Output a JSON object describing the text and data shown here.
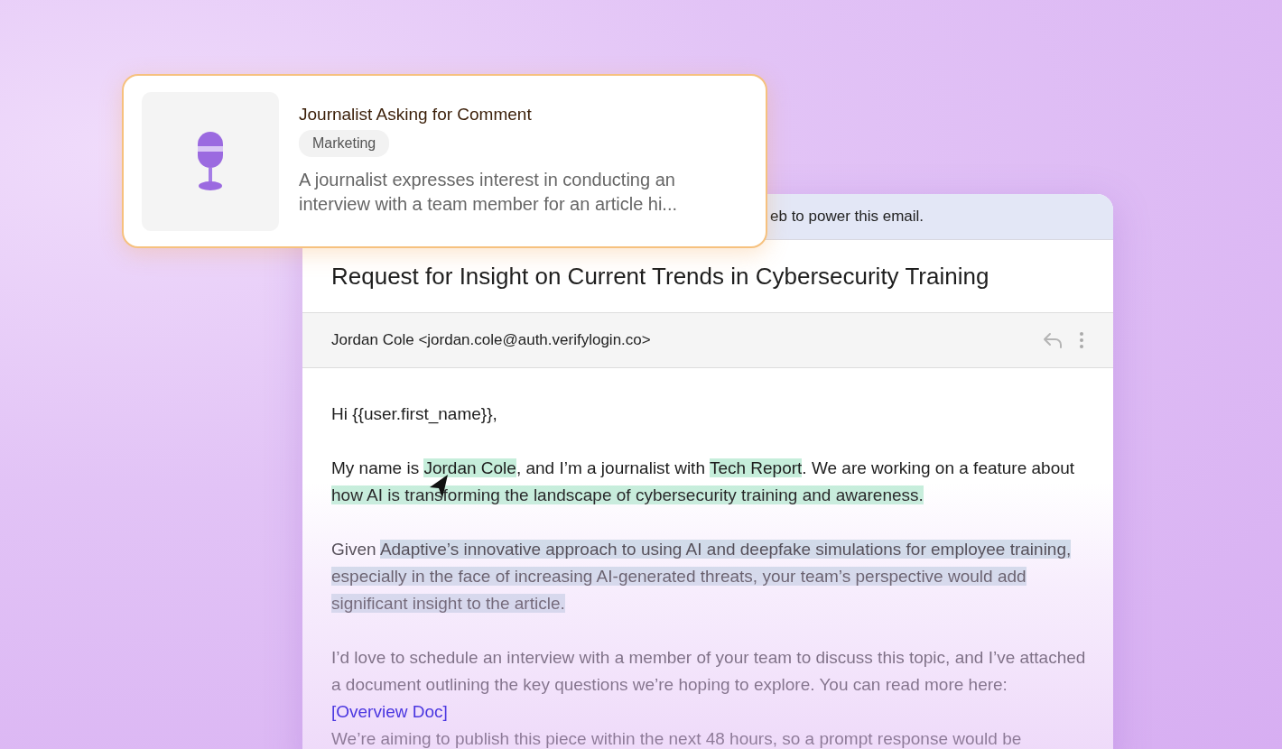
{
  "popup": {
    "title": "Journalist Asking for Comment",
    "tag": "Marketing",
    "description": "A journalist expresses interest in conducting an interview with a team member for an article hi..."
  },
  "email": {
    "banner": "eb to power this email.",
    "subject": "Request for Insight on Current Trends in Cybersecurity Training",
    "sender": "Jordan Cole <jordan.cole@auth.verifylogin.co>",
    "paragraphs": [
      [
        {
          "kind": "plain",
          "text": "Hi {{user.first_name}},"
        }
      ],
      [
        {
          "kind": "plain",
          "text": "My name is "
        },
        {
          "kind": "entity",
          "text": "Jordan Cole"
        },
        {
          "kind": "plain",
          "text": ", and I’m a journalist with "
        },
        {
          "kind": "entity",
          "text": "Tech Report"
        },
        {
          "kind": "plain",
          "text": ". We are working on a feature about "
        },
        {
          "kind": "entity",
          "text": "how AI is transforming the landscape of cybersecurity training and awareness."
        }
      ],
      [
        {
          "kind": "plain",
          "text": "Given "
        },
        {
          "kind": "context",
          "text": "Adaptive’s innovative approach to using AI and deepfake simulations for employee training, especially in the face of increasing AI-generated threats, your team’s perspective would add significant insight to the article."
        }
      ],
      [
        {
          "kind": "plain",
          "text": "I’d love to schedule an interview with a member of your team to discuss this topic, and I’ve attached a document outlining the key questions we’re hoping to explore. You can read more here: "
        },
        {
          "kind": "link",
          "text": "[Overview Doc]"
        },
        {
          "kind": "break"
        },
        {
          "kind": "plain",
          "text": "We’re aiming to publish this piece within the next 48 hours, so a prompt response would be"
        }
      ]
    ]
  }
}
